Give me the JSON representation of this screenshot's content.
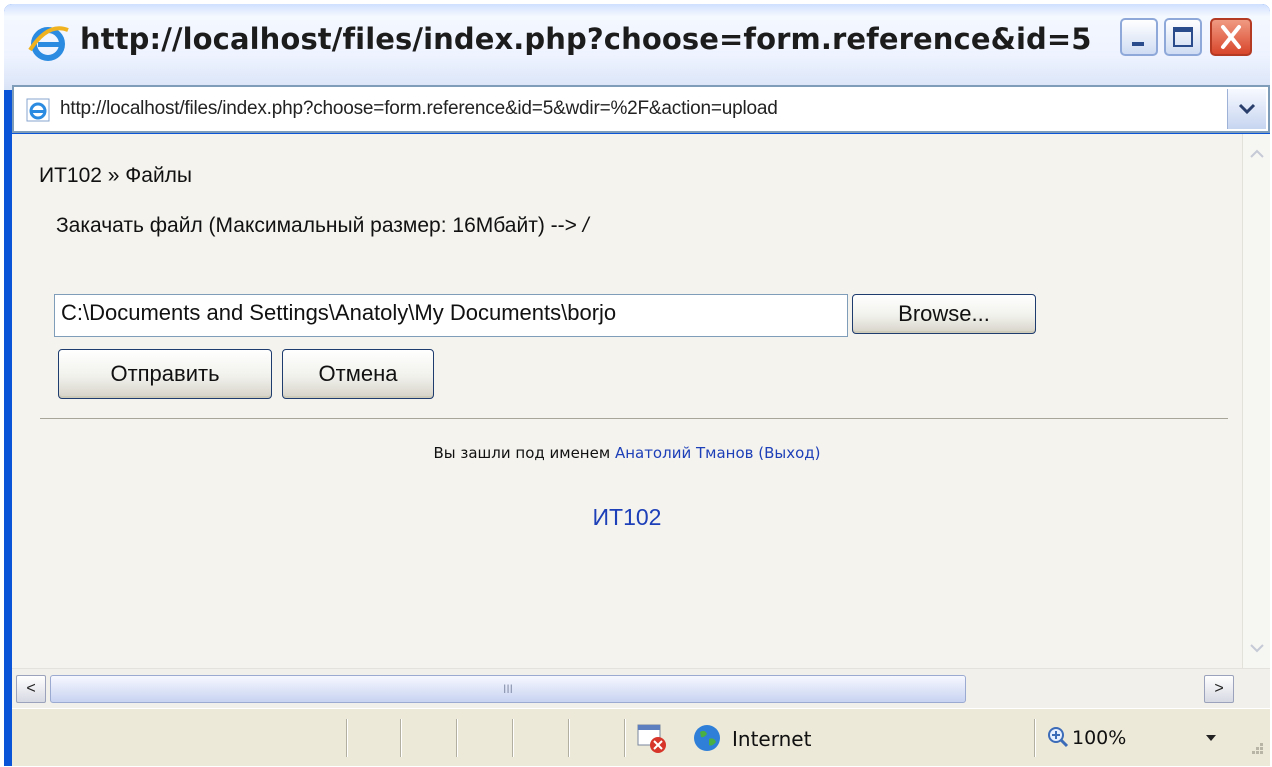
{
  "window": {
    "title": "http://localhost/files/index.php?choose=form.reference&id=5&wdir...",
    "colors": {
      "frame": "#0a54d8",
      "close_button": "#d8462b",
      "link": "#1d3fb8",
      "content_bg": "#f4f3ee"
    }
  },
  "address": {
    "url": "http://localhost/files/index.php?choose=form.reference&id=5&wdir=%2F&action=upload",
    "icon": "ie-page-icon"
  },
  "page": {
    "breadcrumb": "ИТ102 » Файлы",
    "upload_label": "Закачать файл (Максимальный размер: 16Мбайт) -->",
    "upload_dir": "/",
    "file_value": "C:\\Documents and Settings\\Anatoly\\My Documents\\borjo",
    "browse_label": "Browse...",
    "submit_label": "Отправить",
    "cancel_label": "Отмена",
    "login_prefix": "Вы зашли под именем",
    "user_name": "Анатолий Тманов",
    "logout_label": "(Выход)",
    "footer_link": "ИТ102"
  },
  "scrollbar": {
    "thumb_grip": "III",
    "left_arrow": "<",
    "right_arrow": ">"
  },
  "status": {
    "zone": "Internet",
    "zoom": "100%",
    "icons": [
      "popup-blocked-icon",
      "globe-icon",
      "zoom-icon"
    ]
  }
}
